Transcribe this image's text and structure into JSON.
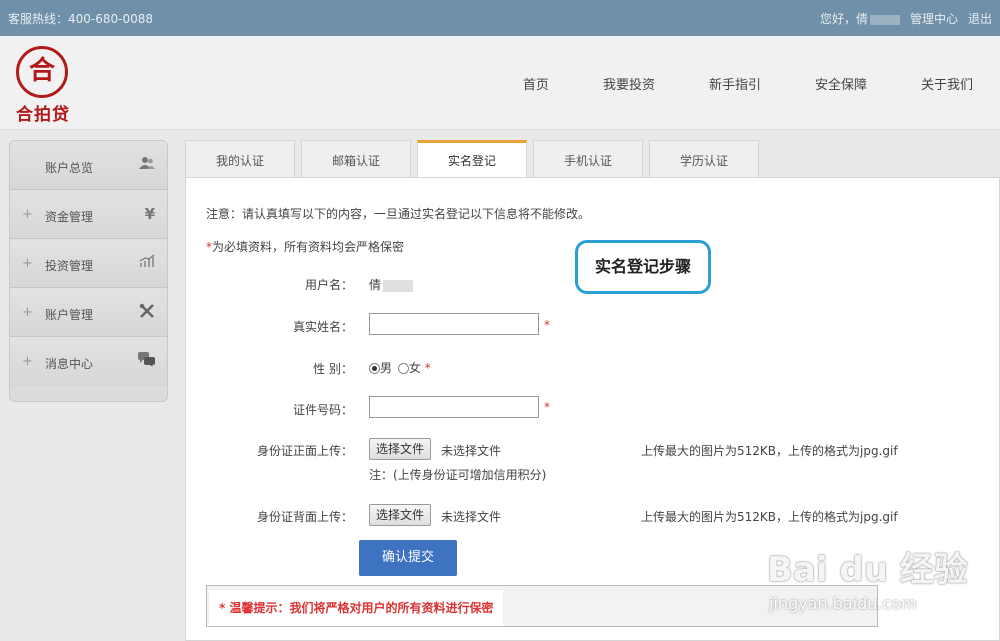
{
  "topbar": {
    "hotline": "客服热线：400-680-0088",
    "greeting": "您好，倩",
    "admin_center": "管理中心",
    "logout": "退出"
  },
  "logo": {
    "seal_char": "合",
    "brand_name": "合拍贷"
  },
  "nav": {
    "items": [
      {
        "label": "首页"
      },
      {
        "label": "我要投资"
      },
      {
        "label": "新手指引"
      },
      {
        "label": "安全保障"
      },
      {
        "label": "关于我们"
      }
    ]
  },
  "sidebar": {
    "items": [
      {
        "label": "账户总览",
        "plus": "",
        "icon": "users-icon"
      },
      {
        "label": "资金管理",
        "plus": "+",
        "icon": "yen-icon"
      },
      {
        "label": "投资管理",
        "plus": "+",
        "icon": "chart-icon"
      },
      {
        "label": "账户管理",
        "plus": "+",
        "icon": "tools-icon"
      },
      {
        "label": "消息中心",
        "plus": "+",
        "icon": "chat-icon"
      }
    ]
  },
  "tabs": [
    {
      "label": "我的认证",
      "active": false
    },
    {
      "label": "邮箱认证",
      "active": false
    },
    {
      "label": "实名登记",
      "active": true
    },
    {
      "label": "手机认证",
      "active": false
    },
    {
      "label": "学历认证",
      "active": false
    }
  ],
  "form": {
    "notice": "注意：请认真填写以下的内容，一旦通过实名登记以下信息将不能修改。",
    "required_star": "*",
    "required_note": "为必填资料，所有资料均会严格保密",
    "username_label": "用户名：",
    "username_value": "倩",
    "realname_label": "真实姓名：",
    "realname_value": "",
    "gender_label": "性 别：",
    "gender_male": "男",
    "gender_female": "女",
    "id_label": "证件号码：",
    "id_value": "",
    "front_label": "身份证正面上传：",
    "back_label": "身份证背面上传：",
    "choose_file": "选择文件",
    "no_file": "未选择文件",
    "upload_hint": "上传最大的图片为512KB，上传的格式为jpg.gif",
    "credit_note": "注：(上传身份证可增加信用积分)",
    "submit": "确认提交",
    "tip": "* 温馨提示：我们将严格对用户的所有资料进行保密"
  },
  "annotation": {
    "bubble_text": "实名登记步骤"
  },
  "watermark": {
    "logo_text": "Bai du 经验",
    "url": "jingyan.baidu.com"
  },
  "colors": {
    "topbar": "#6f90a8",
    "active_tab_accent": "#e8a33d",
    "submit_button": "#3d73c0",
    "required_red": "#dd3333",
    "bubble_border": "#2a9fd6",
    "brand_red": "#b3191a"
  }
}
